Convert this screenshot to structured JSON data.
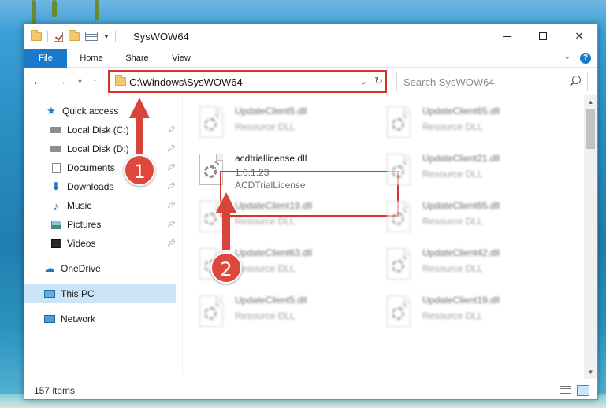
{
  "window": {
    "title": "SysWOW64"
  },
  "ribbon": {
    "file": "File",
    "home": "Home",
    "share": "Share",
    "view": "View",
    "help": "?"
  },
  "address": {
    "path": "C:\\Windows\\SysWOW64"
  },
  "search": {
    "placeholder": "Search SysWOW64"
  },
  "nav": {
    "quick_access": "Quick access",
    "items": [
      {
        "label": "Local Disk (C:)",
        "icon": "drive-icon",
        "pinned": true
      },
      {
        "label": "Local Disk (D:)",
        "icon": "drive-icon",
        "pinned": true
      },
      {
        "label": "Documents",
        "icon": "documents-icon",
        "pinned": true
      },
      {
        "label": "Downloads",
        "icon": "downloads-icon",
        "pinned": true
      },
      {
        "label": "Music",
        "icon": "music-icon",
        "pinned": true
      },
      {
        "label": "Pictures",
        "icon": "pictures-icon",
        "pinned": true
      },
      {
        "label": "Videos",
        "icon": "videos-icon",
        "pinned": true
      }
    ],
    "onedrive": "OneDrive",
    "this_pc": "This PC",
    "network": "Network"
  },
  "files": [
    {
      "name": "UpdateClient5.dll",
      "type": "Resource DLL",
      "blurred": true
    },
    {
      "name": "UpdateClient65.dll",
      "type": "Resource DLL",
      "blurred": true
    },
    {
      "name": "acdtriallicense.dll",
      "version": "1.0.1.23",
      "type": "ACDTrialLicense",
      "blurred": false
    },
    {
      "name": "UpdateClient21.dll",
      "type": "Resource DLL",
      "blurred": true
    },
    {
      "name": "UpdateClient19.dll",
      "type": "Resource DLL",
      "blurred": true
    },
    {
      "name": "UpdateClient65.dll",
      "type": "Resource DLL",
      "blurred": true
    },
    {
      "name": "UpdateClient63.dll",
      "type": "Resource DLL",
      "blurred": true
    },
    {
      "name": "UpdateClient42.dll",
      "type": "Resource DLL",
      "blurred": true
    },
    {
      "name": "UpdateClient5.dll",
      "type": "Resource DLL",
      "blurred": true
    },
    {
      "name": "UpdateClient19.dll",
      "type": "Resource DLL",
      "blurred": true
    }
  ],
  "status": {
    "count": "157 items"
  },
  "annotations": {
    "step1": "1",
    "step2": "2",
    "color": "#d9443a"
  }
}
